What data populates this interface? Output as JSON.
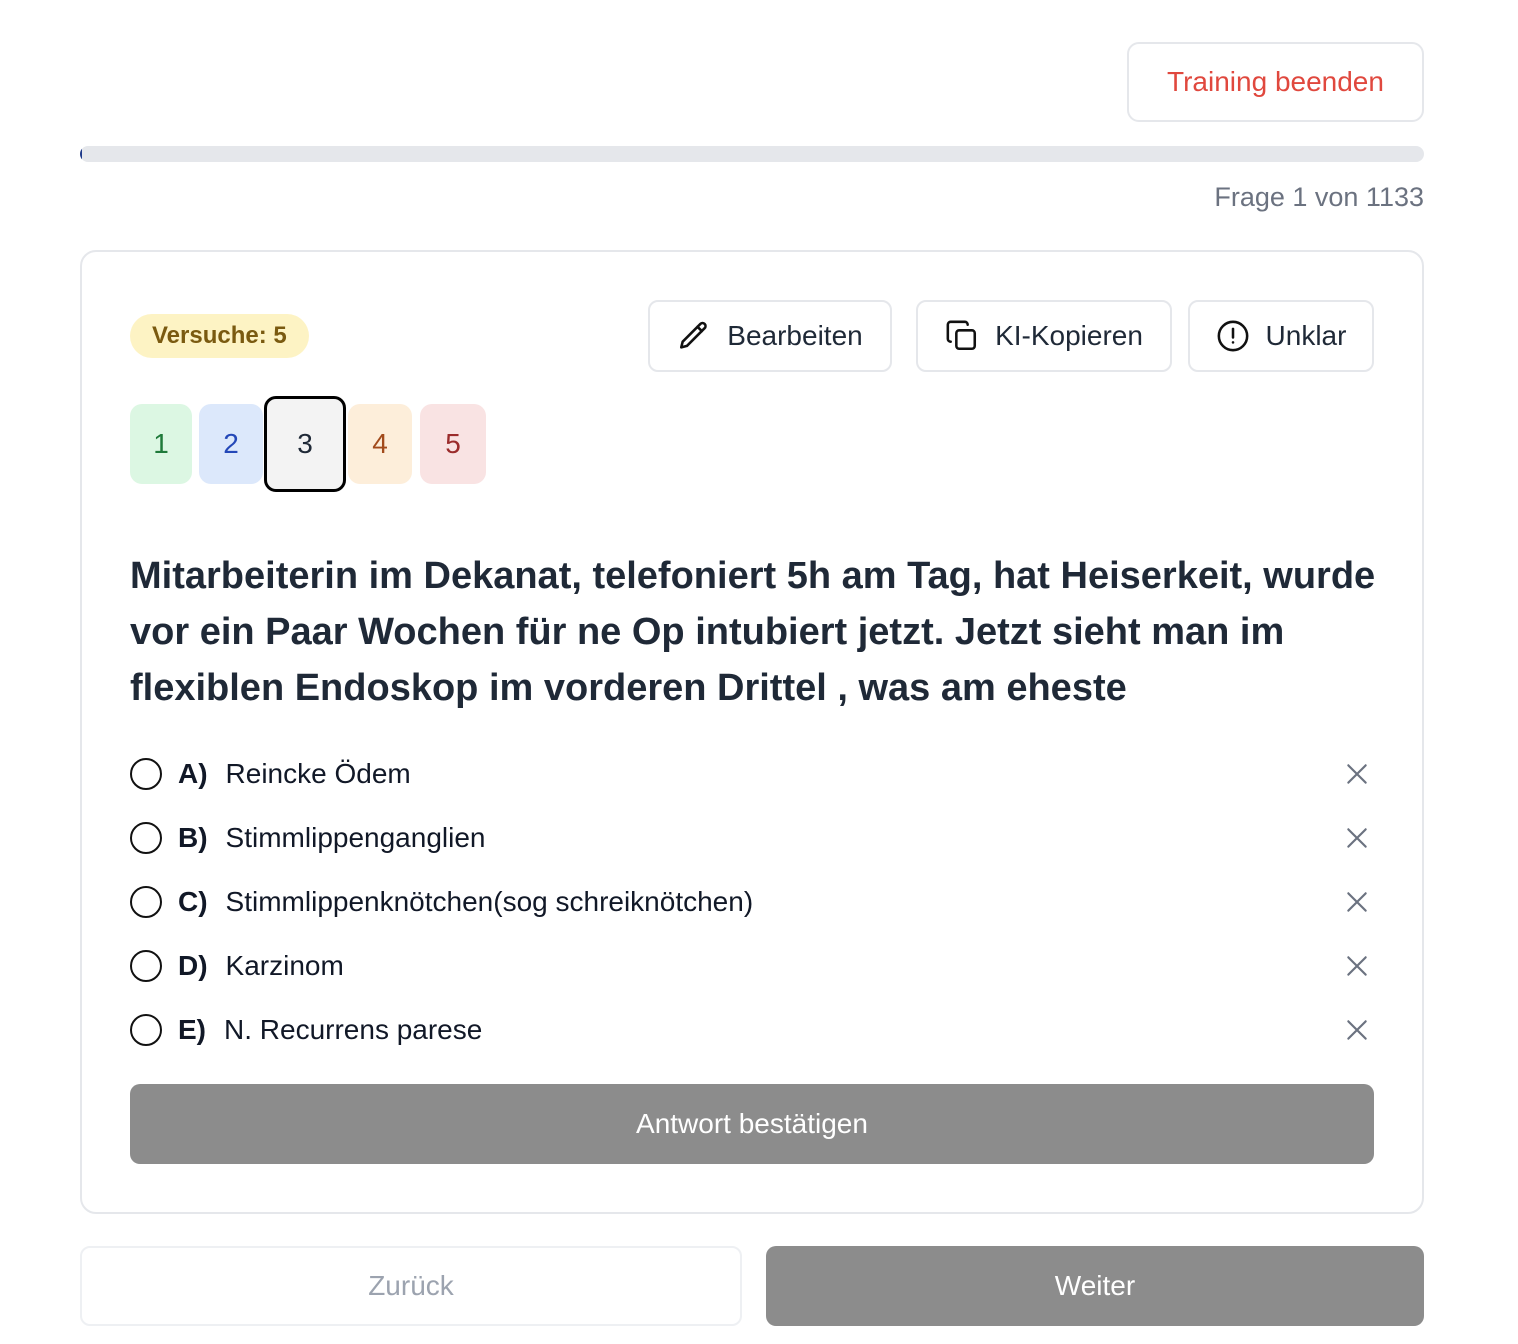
{
  "header": {
    "end_training_label": "Training beenden"
  },
  "progress": {
    "current": 1,
    "total": 1133,
    "fraction": 0.00088,
    "counter_text": "Frage 1 von 1133"
  },
  "card": {
    "attempts_label": "Versuche: 5",
    "actions": {
      "edit": {
        "label": "Bearbeiten",
        "icon": "pencil-icon"
      },
      "copy": {
        "label": "KI-Kopieren",
        "icon": "copy-icon"
      },
      "unclear": {
        "label": "Unklar",
        "icon": "alert-circle-icon"
      }
    },
    "ratings": [
      {
        "label": "1",
        "selected": false
      },
      {
        "label": "2",
        "selected": false
      },
      {
        "label": "3",
        "selected": true
      },
      {
        "label": "4",
        "selected": false
      },
      {
        "label": "5",
        "selected": false
      }
    ],
    "question": "Mitarbeiterin im Dekanat, telefoniert 5h am Tag, hat Heiserkeit, wurde vor ein Paar Wochen für ne Op intubiert jetzt. Jetzt sieht man im flexiblen Endoskop im vorderen Drittel , was am eheste",
    "options": [
      {
        "letter": "A)",
        "text": "Reincke Ödem"
      },
      {
        "letter": "B)",
        "text": "Stimmlippenganglien"
      },
      {
        "letter": "C)",
        "text": "Stimmlippenknötchen(sog schreiknötchen)"
      },
      {
        "letter": "D)",
        "text": "Karzinom"
      },
      {
        "letter": "E)",
        "text": "N. Recurrens parese"
      }
    ],
    "confirm_label": "Antwort bestätigen"
  },
  "footer": {
    "back_label": "Zurück",
    "next_label": "Weiter"
  },
  "colors": {
    "danger": "#e0483e",
    "progress_fill": "#1e3a8a",
    "disabled_button": "#8c8c8c",
    "attempts_badge": "#fdf3c4"
  }
}
